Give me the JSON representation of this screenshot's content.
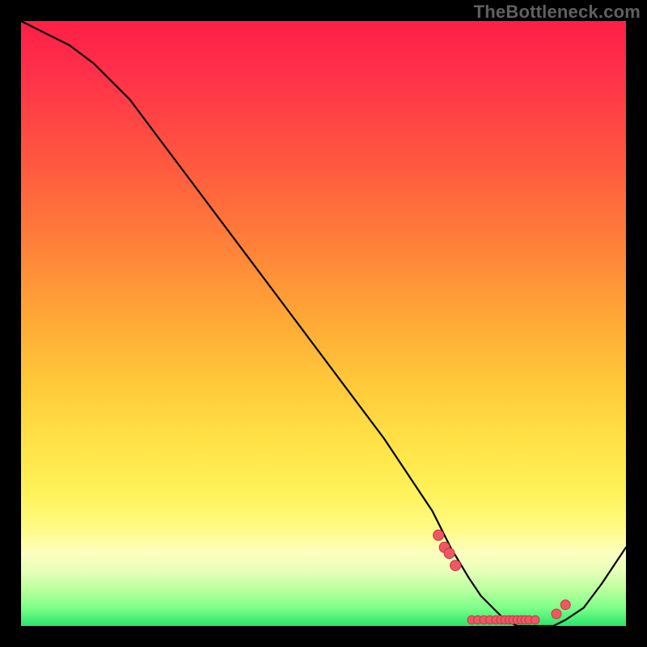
{
  "watermark": "TheBottleneck.com",
  "colors": {
    "dot_fill": "#ef5763",
    "dot_stroke": "#c03b47",
    "curve": "#000000",
    "background": "#000000"
  },
  "chart_data": {
    "type": "line",
    "title": "",
    "xlabel": "",
    "ylabel": "",
    "xlim": [
      0,
      100
    ],
    "ylim": [
      0,
      100
    ],
    "grid": false,
    "legend": false,
    "series": [
      {
        "name": "bottleneck-curve",
        "x": [
          0,
          4,
          8,
          12,
          18,
          24,
          30,
          36,
          42,
          48,
          54,
          60,
          64,
          68,
          71,
          74,
          76,
          78,
          80,
          82,
          85,
          88,
          90,
          93,
          96,
          100
        ],
        "values": [
          100,
          98,
          96,
          93,
          87,
          79,
          71,
          63,
          55,
          47,
          39,
          31,
          25,
          19,
          13,
          8,
          5,
          3,
          1,
          0,
          0,
          0,
          1,
          3,
          7,
          13
        ]
      }
    ],
    "dots": {
      "name": "highlight-points",
      "x": [
        69.0,
        70.0,
        70.8,
        71.8,
        74.5,
        75.5,
        76.5,
        77.5,
        78.5,
        79.3,
        80.0,
        80.7,
        81.3,
        82.0,
        82.7,
        83.3,
        84.0,
        85.0,
        88.5,
        90.0
      ],
      "values": [
        15.0,
        13.0,
        12.0,
        10.0,
        1.0,
        1.0,
        1.0,
        1.0,
        1.0,
        1.0,
        1.0,
        1.0,
        1.0,
        1.0,
        1.0,
        1.0,
        1.0,
        1.0,
        2.0,
        3.5
      ],
      "radius": [
        6.5,
        6.5,
        6.5,
        6.5,
        5.2,
        5.2,
        5.2,
        5.2,
        5.2,
        5.2,
        5.2,
        5.2,
        5.2,
        5.2,
        5.2,
        5.2,
        5.2,
        5.2,
        6.0,
        6.0
      ]
    }
  }
}
